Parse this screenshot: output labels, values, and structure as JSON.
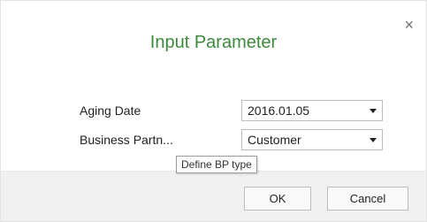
{
  "dialog": {
    "title": "Input Parameter",
    "close_glyph": "×"
  },
  "fields": [
    {
      "label": "Aging Date",
      "value": "2016.01.05",
      "control": "dropdown"
    },
    {
      "label": "Business Partn...",
      "value": "Customer",
      "control": "dropdown"
    }
  ],
  "tooltip": {
    "text": "Define BP type"
  },
  "buttons": {
    "ok_label": "OK",
    "cancel_label": "Cancel"
  },
  "colors": {
    "title": "#3d8a3d",
    "footer_bg": "#f1f1f1"
  }
}
